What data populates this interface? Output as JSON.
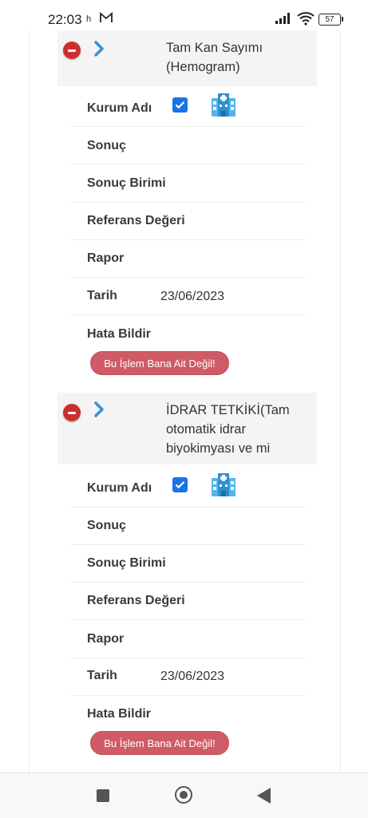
{
  "status_bar": {
    "time": "22:03",
    "indicator_h": "h",
    "battery": "57"
  },
  "records": [
    {
      "test_name": "Tam Kan Sayımı (Hemogram)",
      "kurum_adi_label": "Kurum Adı",
      "kurum_checked": true,
      "sonuc_label": "Sonuç",
      "sonuc_birimi_label": "Sonuç Birimi",
      "referans_label": "Referans Değeri",
      "rapor_label": "Rapor",
      "tarih_label": "Tarih",
      "tarih_value": "23/06/2023",
      "hata_label": "Hata Bildir",
      "hata_button": "Bu İşlem Bana Ait Değil!"
    },
    {
      "test_name": "İDRAR TETKİKİ(Tam otomatik idrar biyokimyası ve mi",
      "kurum_adi_label": "Kurum Adı",
      "kurum_checked": true,
      "sonuc_label": "Sonuç",
      "sonuc_birimi_label": "Sonuç Birimi",
      "referans_label": "Referans Değeri",
      "rapor_label": "Rapor",
      "tarih_label": "Tarih",
      "tarih_value": "23/06/2023",
      "hata_label": "Hata Bildir",
      "hata_button": "Bu İşlem Bana Ait Değil!"
    }
  ],
  "colors": {
    "minus_button": "#c9302c",
    "chevron": "#3b8fd8",
    "checkbox": "#1a73e8",
    "error_button": "#cf5b66",
    "header_bg": "#f4f4f5"
  },
  "icons": {
    "remove": "minus-circle-icon",
    "expand": "chevron-right-icon",
    "institution": "hospital-building-icon"
  }
}
